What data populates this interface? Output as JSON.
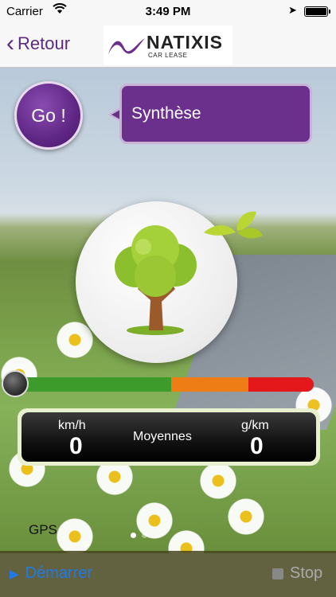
{
  "status_bar": {
    "carrier": "Carrier",
    "time": "3:49 PM"
  },
  "nav": {
    "back_label": "Retour",
    "logo": {
      "brand": "NATIXIS",
      "sub": "CAR LEASE"
    }
  },
  "go_label": "Go !",
  "synthese_label": "Synthèse",
  "eco_gauge": {
    "level_fraction": 0.0,
    "zones": [
      "green",
      "orange",
      "red"
    ]
  },
  "stats": {
    "speed_unit": "km/h",
    "speed_value": "0",
    "center_label": "Moyennes",
    "co2_unit": "g/km",
    "co2_value": "0"
  },
  "gps_label": "GPS",
  "page_indicator": {
    "count": 2,
    "current": 1
  },
  "toolbar": {
    "start_label": "Démarrer",
    "stop_label": "Stop"
  },
  "colors": {
    "brand_purple": "#6b2f8c",
    "ios_blue": "#1e7ae8",
    "gauge_green": "#3c9b2a",
    "gauge_orange": "#ef7d16",
    "gauge_red": "#e4181a"
  }
}
